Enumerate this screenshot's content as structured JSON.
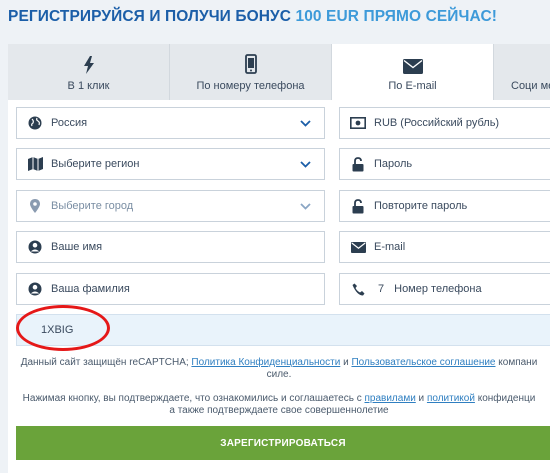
{
  "header": {
    "title_main": "РЕГИСТРИРУЙСЯ И ПОЛУЧИ БОНУС ",
    "title_accent": "100 EUR ПРЯМО СЕЙЧАС!"
  },
  "tabs": [
    {
      "label": "В 1 клик",
      "icon": "lightning-icon"
    },
    {
      "label": "По номеру телефона",
      "icon": "phone-icon"
    },
    {
      "label": "По E-mail",
      "icon": "envelope-icon",
      "active": true
    },
    {
      "label": "Соци ме",
      "icon": "social-icon"
    }
  ],
  "form": {
    "country": "Россия",
    "currency": "RUB (Российский рубль)",
    "region_placeholder": "Выберите регион",
    "password_placeholder": "Пароль",
    "city_placeholder": "Выберите город",
    "repeat_password_placeholder": "Повторите пароль",
    "first_name_placeholder": "Ваше имя",
    "email_placeholder": "E-mail",
    "last_name_placeholder": "Ваша фамилия",
    "phone_code": "7",
    "phone_placeholder": "Номер телефона",
    "promo_code": "1XBIG"
  },
  "recaptcha": {
    "prefix": "Данный сайт защищён reCAPTCHA; ",
    "privacy_link": "Политика Конфиденциальности",
    "and": " и ",
    "terms_link": "Пользовательское соглашение",
    "suffix": " компани",
    "line2": "силе."
  },
  "consent": {
    "prefix": "Нажимая кнопку, вы подтверждаете, что ознакомились и соглашаетесь с ",
    "rules_link": "правилами",
    "and": " и ",
    "policy_link": "политикой",
    "suffix": " конфиденци",
    "line2": "а также подтверждаете свое совершеннолетие"
  },
  "submit_label": "ЗАРЕГИСТРИРОВАТЬСЯ",
  "colors": {
    "title_dark": "#1b5ea8",
    "title_accent": "#3d9ad9",
    "button_green": "#6aa33a",
    "highlight_red": "#e51818"
  }
}
